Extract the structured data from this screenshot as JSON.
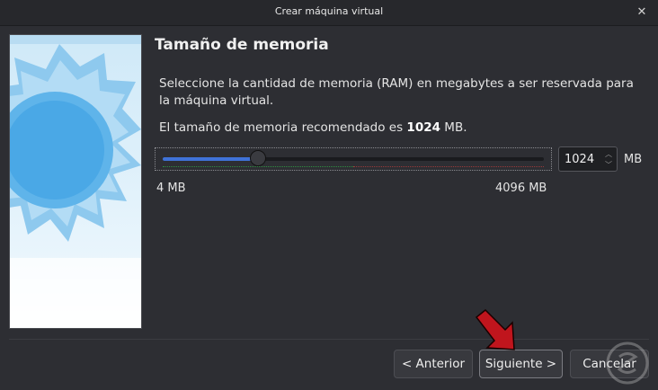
{
  "window": {
    "title": "Crear máquina virtual",
    "close_icon": "close-icon"
  },
  "page": {
    "heading": "Tamaño de memoria",
    "description": "Seleccione la cantidad de memoria (RAM) en megabytes a ser reservada para la máquina virtual.",
    "recommend_prefix": "El tamaño de memoria recomendado es ",
    "recommend_value": "1024",
    "recommend_suffix": " MB."
  },
  "memory": {
    "value": "1024",
    "unit": "MB",
    "min_label": "4 MB",
    "max_label": "4096 MB",
    "min": 4,
    "max": 4096,
    "current": 1024,
    "slider_color": "#3f72d8"
  },
  "buttons": {
    "back": "< Anterior",
    "next": "Siguiente >",
    "cancel": "Cancelar"
  },
  "annotation": {
    "arrow_color": "#c0151d"
  }
}
